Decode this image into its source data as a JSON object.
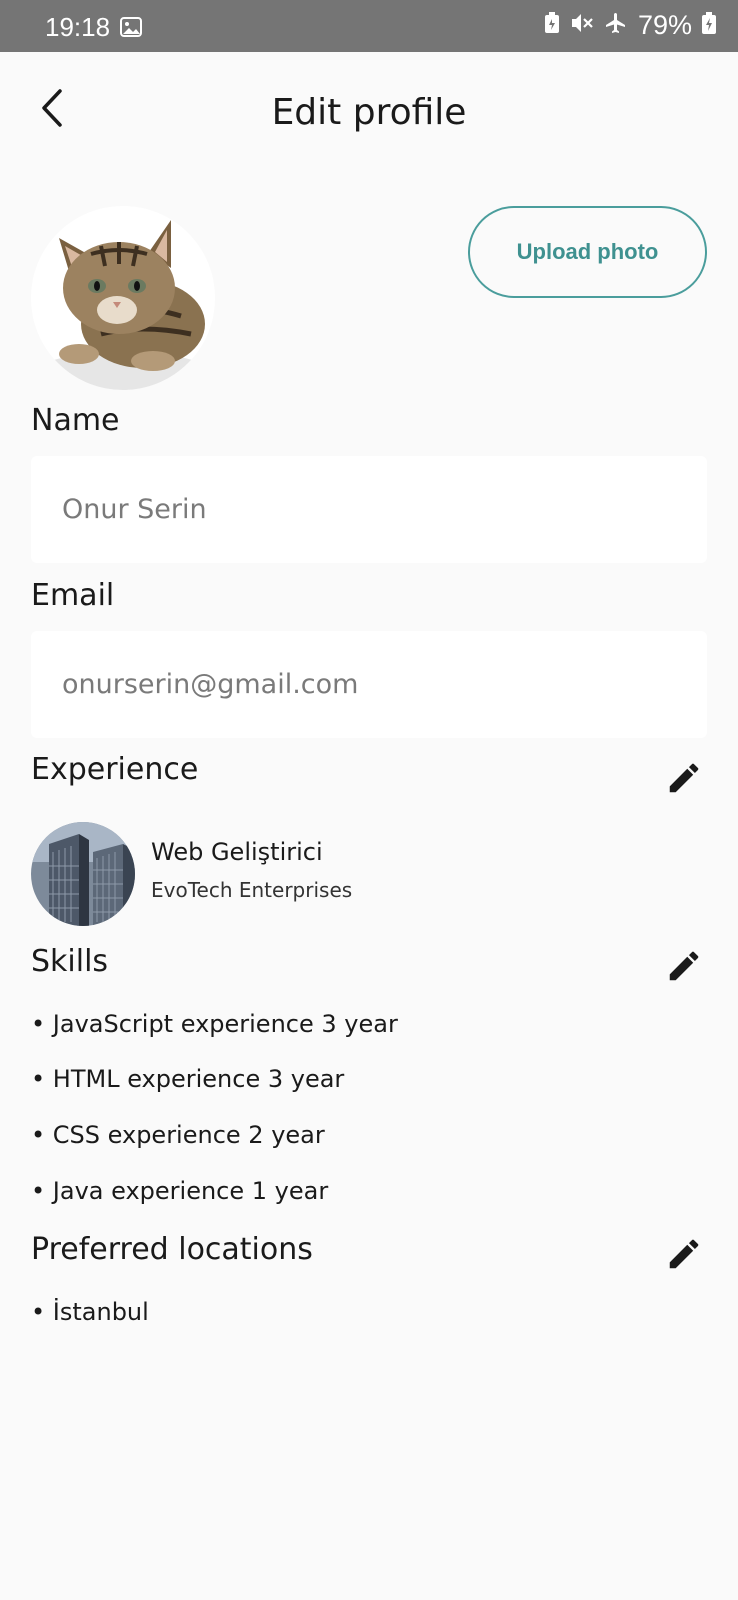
{
  "status_bar": {
    "time": "19:18",
    "battery": "79%",
    "icons": [
      "gallery-icon",
      "battery-saver-icon",
      "mute-icon",
      "airplane-icon",
      "battery-charging-icon"
    ]
  },
  "header": {
    "title": "Edit profile",
    "back_icon": "chevron-left-icon"
  },
  "profile": {
    "upload_label": "Upload photo"
  },
  "name": {
    "label": "Name",
    "value": "Onur Serin"
  },
  "email": {
    "label": "Email",
    "value": "onurserin@gmail.com"
  },
  "experience": {
    "title": "Experience",
    "role": "Web Geliştirici",
    "company": "EvoTech Enterprises"
  },
  "skills": {
    "title": "Skills",
    "items": [
      "• JavaScript experience 3 year",
      "• HTML experience 3 year",
      "• CSS experience 2 year",
      "• Java experience 1 year"
    ]
  },
  "locations": {
    "title": "Preferred locations",
    "items": [
      "• İstanbul"
    ]
  },
  "colors": {
    "accent": "#4a9d9c",
    "status_bar": "#757575",
    "background": "#fafafa"
  }
}
